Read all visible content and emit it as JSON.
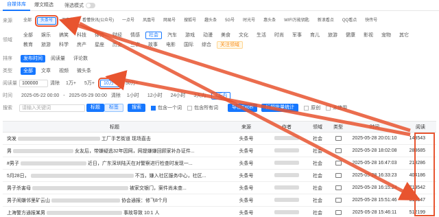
{
  "tabs": [
    {
      "label": "自媒体库",
      "active": true
    },
    {
      "label": "爆文精选",
      "active": false
    }
  ],
  "filter_mode": {
    "label": "筛选模式",
    "on": false
  },
  "source": {
    "label": "来源",
    "options": [
      "全部",
      "头条号",
      "百家号",
      "看懂快讯(公众号)",
      "一点号",
      "凤凰号",
      "网易号",
      "搜狐号",
      "趣头条",
      "5G号",
      "时光号",
      "惠头条",
      "WIFI万能钥匙",
      "新浪看点",
      "QQ看点",
      "快传号"
    ],
    "selected": "头条号"
  },
  "domain": {
    "label": "领域",
    "line1": [
      "全部",
      "娱乐",
      "搞笑",
      "科技",
      "体育",
      "财经",
      "情感",
      "社会",
      "汽车",
      "游戏",
      "动漫",
      "美食",
      "文化",
      "生活",
      "时尚",
      "军事",
      "育儿",
      "旅游",
      "健康",
      "影视",
      "宠物",
      "其它"
    ],
    "line2": [
      "教育",
      "旅游",
      "科学",
      "房产",
      "星座",
      "历史",
      "三农",
      "故事",
      "电影",
      "国际",
      "综合"
    ],
    "selected": "社会",
    "follow_tag": "关注领域"
  },
  "sort": {
    "label": "排序",
    "options": [
      "发布时间",
      "阅读量",
      "评论数"
    ],
    "selected": "发布时间"
  },
  "type": {
    "label": "类型",
    "options": [
      "全部",
      "文章",
      "视频",
      "微头条"
    ],
    "selected": "全部"
  },
  "reads": {
    "label": "阅读量",
    "input_value": "100000",
    "clear_label": "清除",
    "presets": [
      "1万+",
      "5万+",
      "10万+",
      "50万+"
    ],
    "selected": "10万+"
  },
  "time": {
    "label": "时间",
    "start": "2025-05-22 00:00",
    "separator": "-",
    "end": "2025-05-29 00:00",
    "clear_label": "清除",
    "presets": [
      "1小时",
      "12小时",
      "24小时",
      "3天内",
      "7天内"
    ],
    "selected": "7天内"
  },
  "search": {
    "label": "搜索",
    "placeholder": "请输入关键词",
    "mode_title": "标题",
    "mode_body": "标签",
    "search_button": "搜索",
    "contains_one": "包含一个词",
    "contains_all": "包含所有词",
    "export_button": "导出Excel",
    "batch_button": "标题批量统计",
    "original": "原创",
    "not_used": "未使用"
  },
  "table": {
    "headers": {
      "title": "标题",
      "source": "来源",
      "author": "作者",
      "domain": "领域",
      "type": "类型",
      "time": "时间",
      "reads": "阅读"
    },
    "rows": [
      {
        "title_start": "突发",
        "title_end": "工厂手艺街道 现场直击",
        "source": "头条号",
        "domain": "社会",
        "time": "2025-05-28 20:01:10",
        "reads": "143543"
      },
      {
        "title_start": "男",
        "title_end": "女友后，带嫌疑逃32年因网，网提嫌嫌回顾家补办证件...",
        "source": "头条号",
        "domain": "社会",
        "time": "2025-05-28 18:02:08",
        "reads": "283685"
      },
      {
        "title_start": "#男子",
        "title_end": "近日，广东深圳陆天在对警察进行检查时发现一...",
        "source": "头条号",
        "domain": "社会",
        "time": "2025-05-28 16:47:03",
        "reads": "218286"
      },
      {
        "title_start": "5月28日，",
        "title_end": "不当，嫌入社区服务中心，社区...",
        "source": "头条号",
        "domain": "社会",
        "time": "2025-05-28 16:33:23",
        "reads": "404186"
      },
      {
        "title_start": "男子杀害母",
        "title_end": "被家交银门，案件尚未查...",
        "source": "头条号",
        "domain": "社会",
        "time": "2025-05-28 16:15:24",
        "reads": "1719542"
      },
      {
        "title_start": "男子闹嫌邻里矿云山",
        "title_end": "协会通报：修飞8个月",
        "source": "头条号",
        "domain": "社会",
        "time": "2025-05-28 15:51:46",
        "reads": "318547"
      },
      {
        "title_start": "上海警方通报某男",
        "title_end": "事故导致 10:1 人",
        "source": "头条号",
        "domain": "社会",
        "time": "2025-05-28 15:46:11",
        "reads": "512199"
      }
    ]
  },
  "colors": {
    "accent": "#1677ff",
    "annotation": "#e8542f"
  }
}
